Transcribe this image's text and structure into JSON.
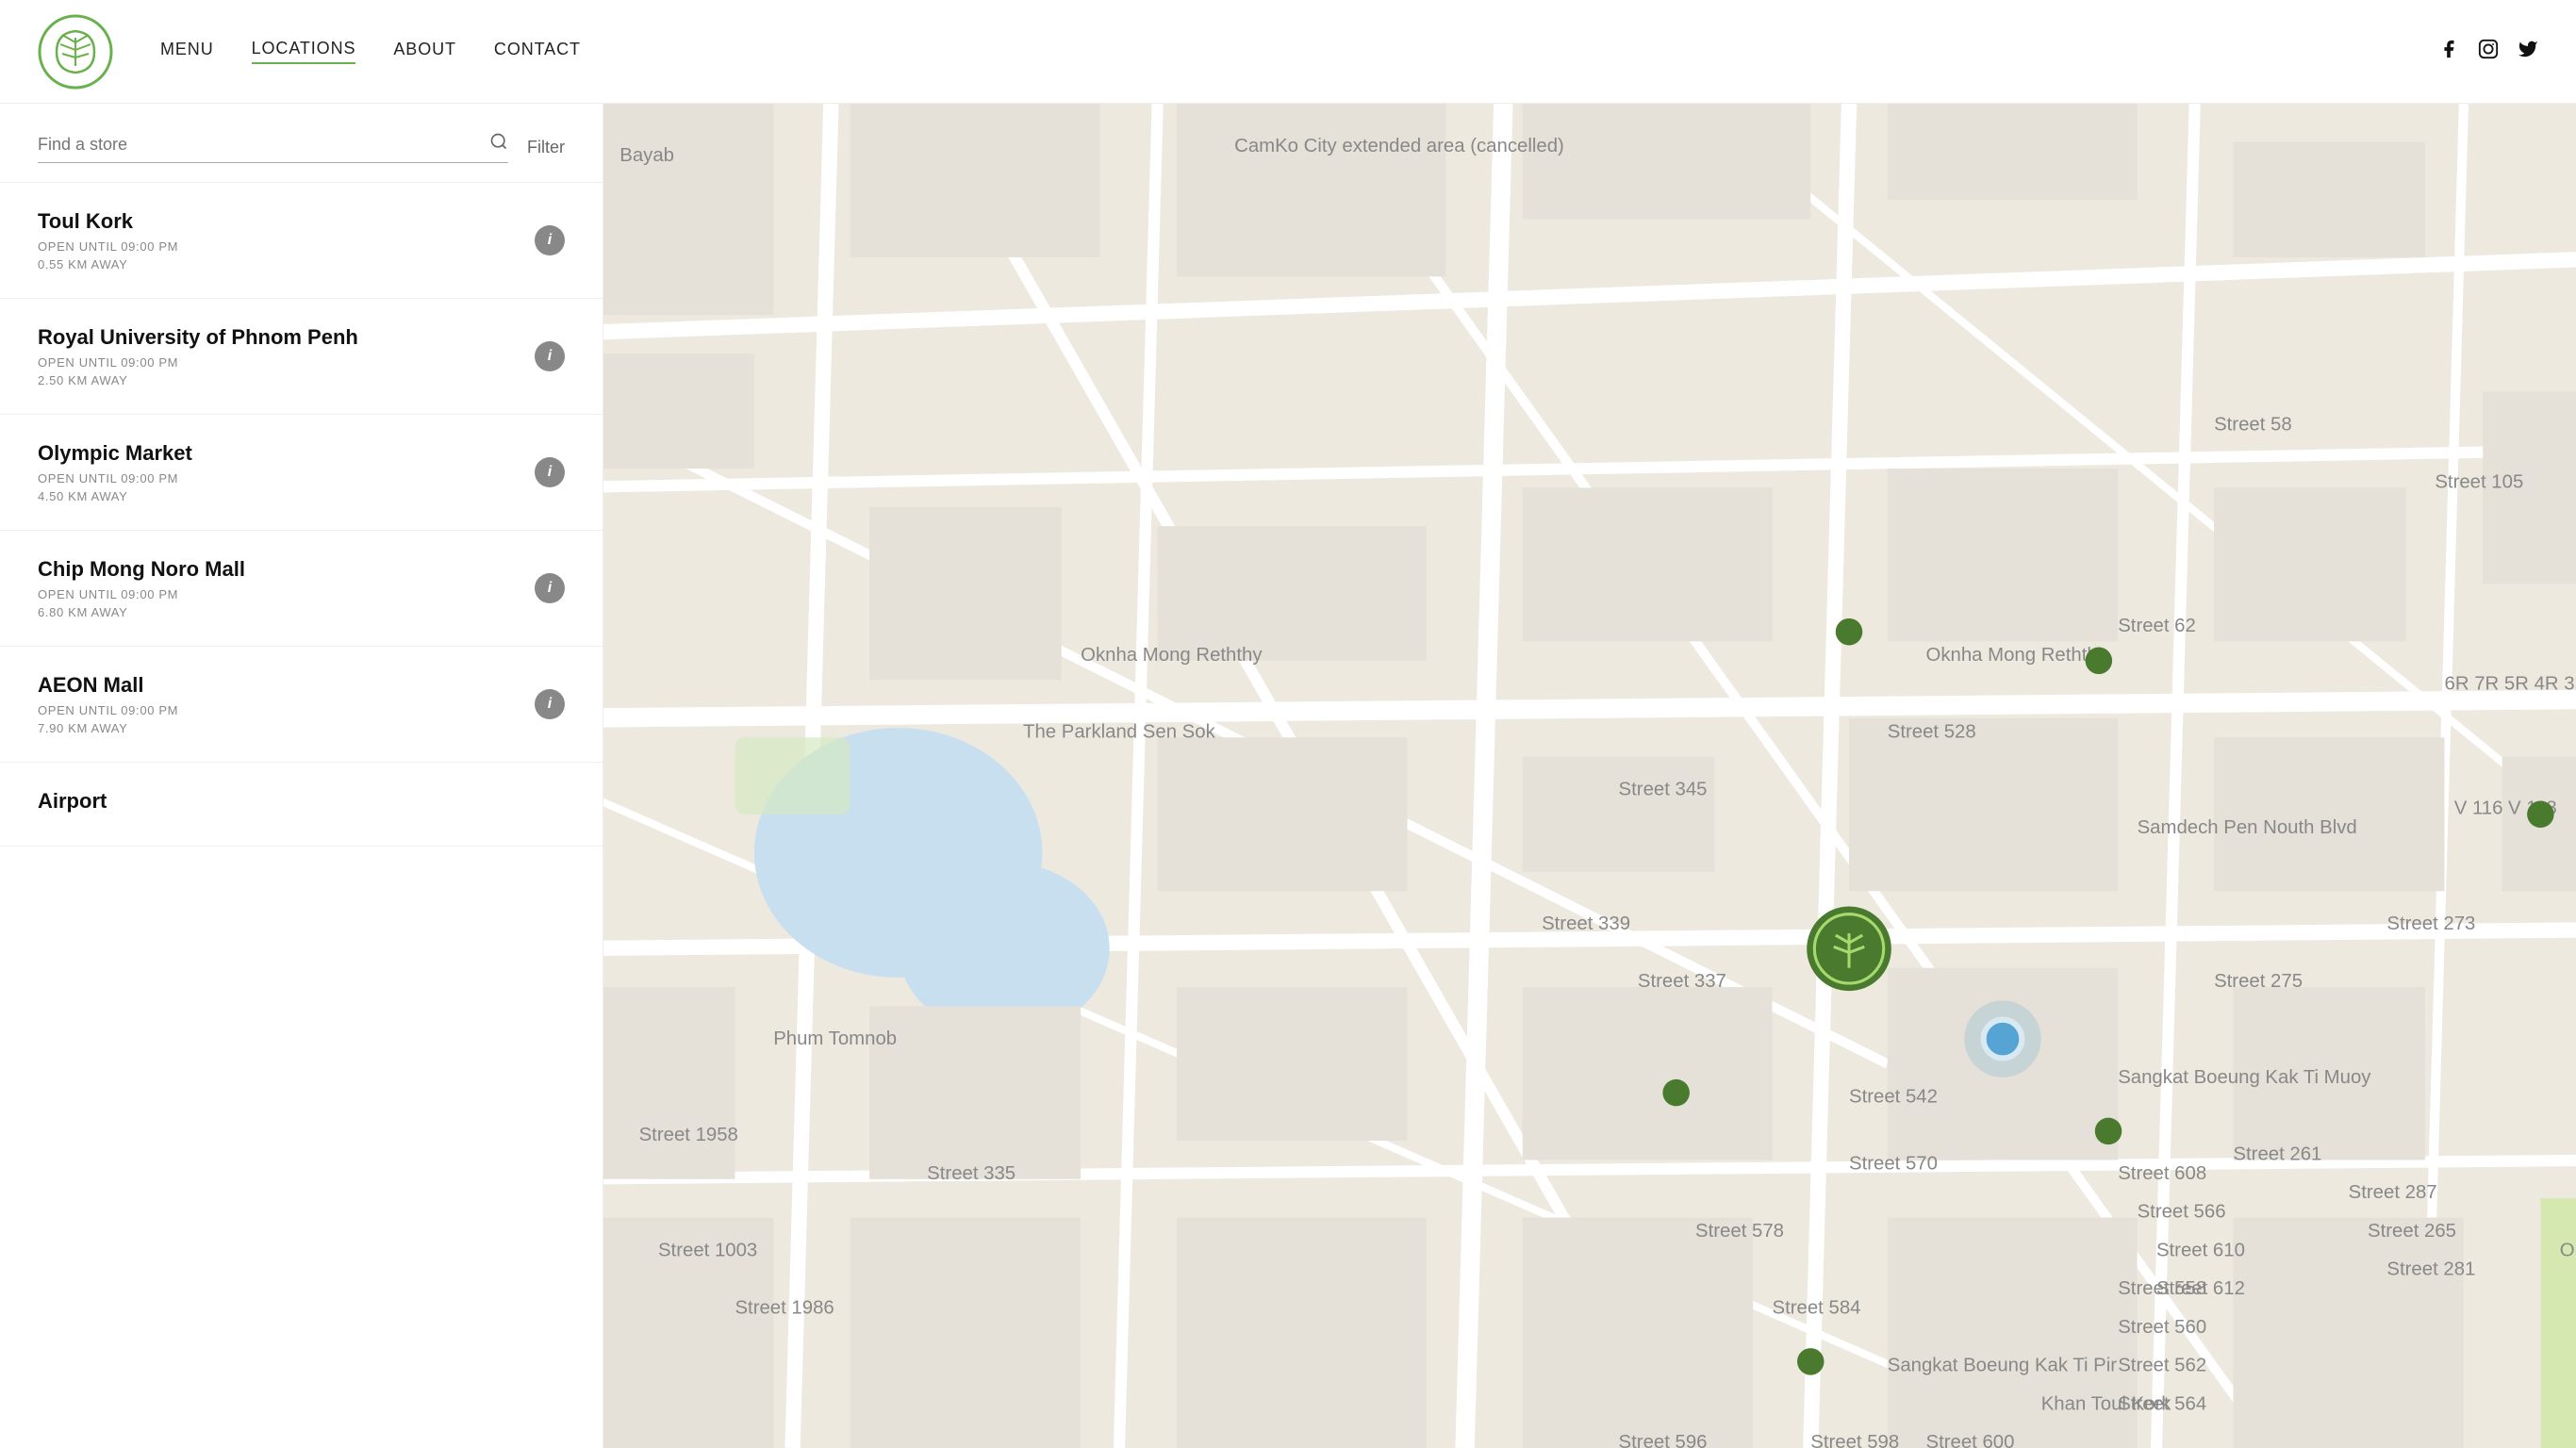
{
  "header": {
    "nav": [
      {
        "id": "menu",
        "label": "MENU",
        "active": false
      },
      {
        "id": "locations",
        "label": "LOCATIONS",
        "active": true
      },
      {
        "id": "about",
        "label": "ABOUT",
        "active": false
      },
      {
        "id": "contact",
        "label": "CONTACT",
        "active": false
      }
    ],
    "social": [
      {
        "id": "facebook",
        "icon": "f",
        "label": "Facebook"
      },
      {
        "id": "instagram",
        "icon": "◻",
        "label": "Instagram"
      },
      {
        "id": "twitter",
        "icon": "t",
        "label": "Twitter"
      }
    ]
  },
  "search": {
    "placeholder": "Find a store",
    "filter_label": "Filter"
  },
  "stores": [
    {
      "name": "Toul Kork",
      "hours": "OPEN UNTIL 09:00 PM",
      "distance": "0.55 KM AWAY"
    },
    {
      "name": "Royal University of Phnom Penh",
      "hours": "OPEN UNTIL 09:00 PM",
      "distance": "2.50 KM AWAY"
    },
    {
      "name": "Olympic Market",
      "hours": "OPEN UNTIL 09:00 PM",
      "distance": "4.50 KM AWAY"
    },
    {
      "name": "Chip Mong Noro Mall",
      "hours": "OPEN UNTIL 09:00 PM",
      "distance": "6.80 KM AWAY"
    },
    {
      "name": "AEON Mall",
      "hours": "OPEN UNTIL 09:00 PM",
      "distance": "7.90 KM AWAY"
    },
    {
      "name": "Airport",
      "hours": "",
      "distance": ""
    }
  ],
  "info_button_label": "i",
  "logo_alt": "Tea brand logo"
}
